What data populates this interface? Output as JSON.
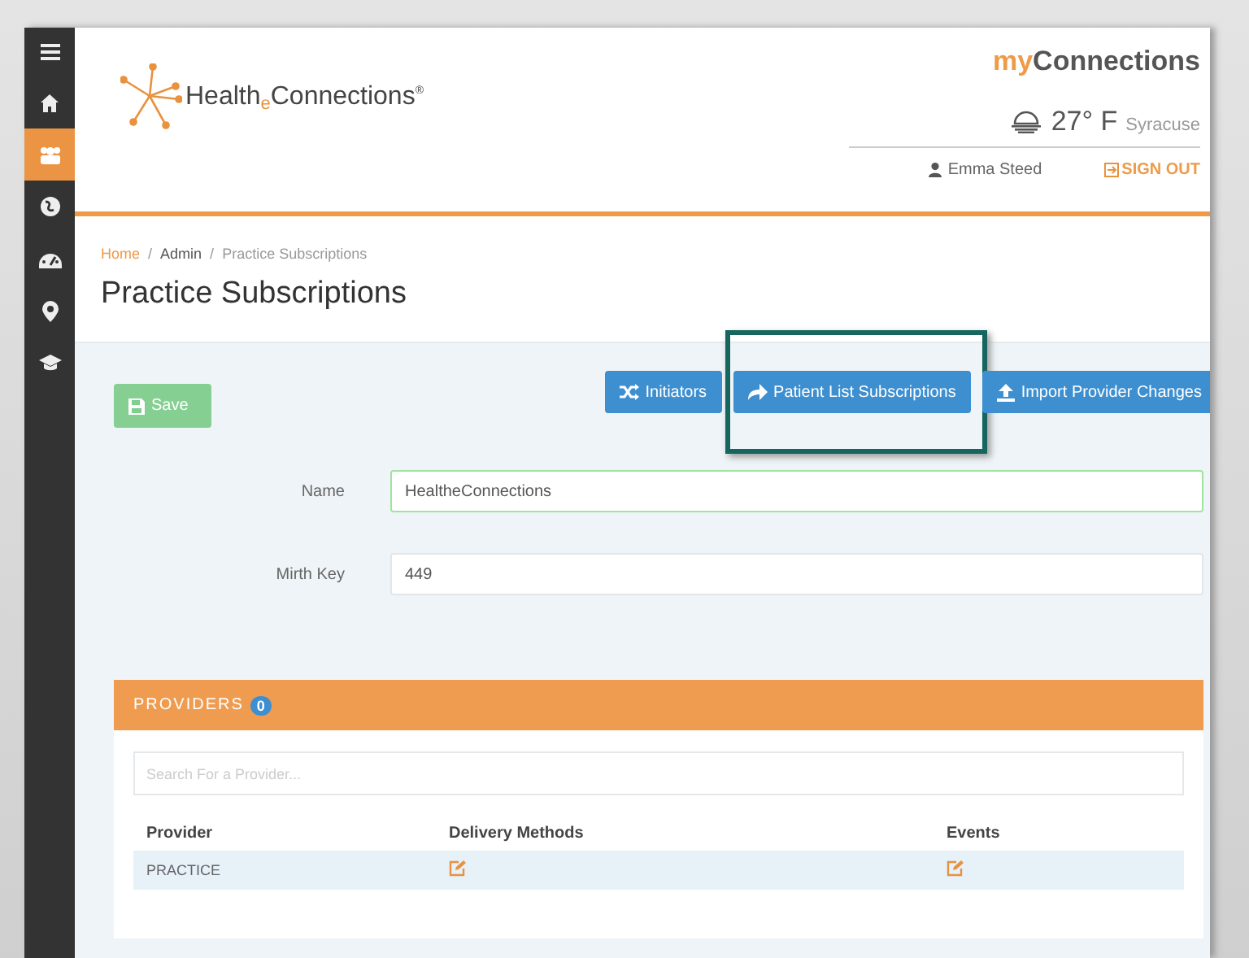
{
  "sidebar": {
    "items": [
      {
        "kind": "menu",
        "selected": false
      },
      {
        "kind": "home",
        "selected": false
      },
      {
        "kind": "group",
        "selected": true
      },
      {
        "kind": "globe",
        "selected": false
      },
      {
        "kind": "dashboard",
        "selected": false
      },
      {
        "kind": "pin",
        "selected": false
      },
      {
        "kind": "cap",
        "selected": false
      }
    ]
  },
  "header": {
    "logo": "Health$_{e}$Connections$^{®}$",
    "app_title": {
      "accent": "my",
      "rest": "Connections"
    },
    "weather": {
      "temperature": "27° F",
      "city": "Syracuse"
    },
    "user": "Emma Steed",
    "sign_out": "SIGN OUT"
  },
  "breadcrumbs": [
    {
      "label": "Home",
      "link": true
    },
    {
      "separator": "/",
      "label": "Admin",
      "link": false
    },
    {
      "separator": "/",
      "label": "Practice Subscriptions",
      "link": false
    }
  ],
  "page_title": "Practice Subscriptions",
  "save_button": {
    "label": "Save",
    "disabled": true
  },
  "actions": [
    {
      "kind": "shuffle",
      "label": "Initiators",
      "highlighted": false
    },
    {
      "kind": "share",
      "label": "Patient List Subscriptions",
      "highlighted": true
    },
    {
      "kind": "upload",
      "label": "Import Provider Changes",
      "highlighted": false
    }
  ],
  "form": [
    {
      "label": "Name",
      "value": "HealtheConnections",
      "focused": true
    },
    {
      "label": "Mirth Key",
      "value": "449",
      "focused": false
    }
  ],
  "providers": {
    "title": "PROVIDERS",
    "count": "0",
    "search_placeholder": "Search For a Provider...",
    "columns": [
      "Provider",
      "Delivery Methods",
      "Events"
    ],
    "rows": [
      {
        "provider": "PRACTICE"
      }
    ]
  }
}
